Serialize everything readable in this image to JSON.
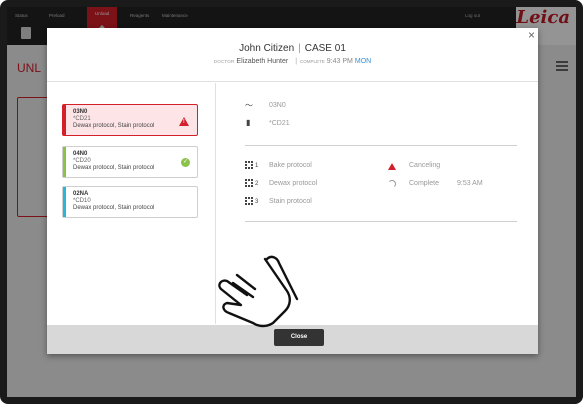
{
  "app": {
    "nav": [
      "Status",
      "Preload",
      "Unload",
      "Reagents",
      "Maintenance"
    ],
    "active_nav": "Unload",
    "logout": "Log out",
    "logo": "Leica",
    "logo_sub": "",
    "title": "UNL",
    "accent": "#d4202a"
  },
  "modal": {
    "close_x": "×",
    "title_name": "John Citizen",
    "title_sep": "|",
    "title_case": "CASE 01",
    "doctor_label": "DOCTOR",
    "doctor_name": "Elizabeth Hunter",
    "sub_sep": "|",
    "complete_label": "COMPLETE",
    "complete_time": "9:43 PM",
    "complete_day": "MON",
    "close_button": "Close"
  },
  "slides": [
    {
      "id": "03N0",
      "code": "*CD21",
      "protocols": "Dewax protocol, Stain protocol",
      "status": "warning",
      "color": "#d4202a"
    },
    {
      "id": "04N0",
      "code": "*CD20",
      "protocols": "Dewax protocol, Stain protocol",
      "status": "ok",
      "color": "#8bc34a"
    },
    {
      "id": "02NA",
      "code": "*CD10",
      "protocols": "Dewax protocol, Stain protocol",
      "status": "",
      "color": "#29b6d8"
    }
  ],
  "details": {
    "slide_id": "03N0",
    "slide_code": "*CD21",
    "steps": [
      {
        "num": "1",
        "name": "Bake protocol",
        "status": "Canceling",
        "time": ""
      },
      {
        "num": "2",
        "name": "Dewax protocol",
        "status": "Complete",
        "time": "9:53 AM"
      },
      {
        "num": "3",
        "name": "Stain protocol",
        "status": "",
        "time": ""
      }
    ]
  }
}
